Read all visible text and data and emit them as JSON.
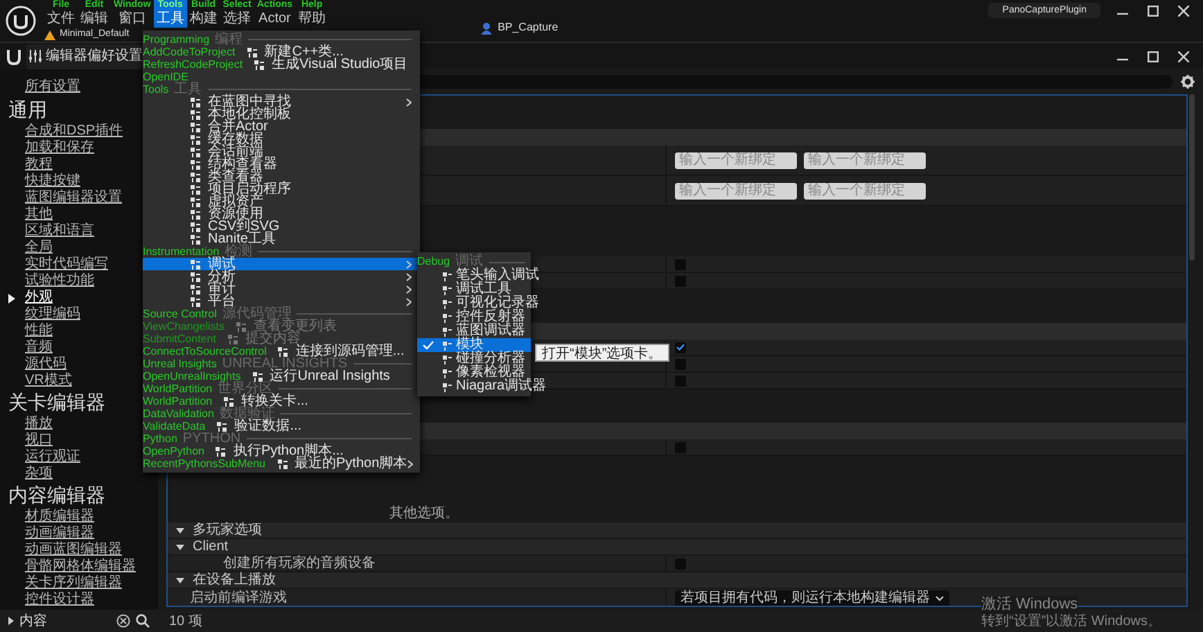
{
  "menu_bar": [
    {
      "debug_name": "File",
      "label": "文件",
      "selected": false
    },
    {
      "debug_name": "Edit",
      "label": "编辑",
      "selected": false
    },
    {
      "debug_name": "Window",
      "label": "窗口",
      "selected": false
    },
    {
      "debug_name": "Tools",
      "label": "工具",
      "selected": true
    },
    {
      "debug_name": "Build",
      "label": "构建",
      "selected": false
    },
    {
      "debug_name": "Select",
      "label": "选择",
      "selected": false
    },
    {
      "debug_name": "Actions",
      "label": "Actor",
      "selected": false
    },
    {
      "debug_name": "Help",
      "label": "帮助",
      "selected": false
    }
  ],
  "level_tab": "Minimal_Default",
  "blueprint_tab": "BP_Capture",
  "project_name": "PanoCapturePlugin",
  "settings_window": {
    "tab": "编辑器偏好设置"
  },
  "sidebar": {
    "all_settings": "所有设置",
    "sections": [
      {
        "title": "通用",
        "items": [
          {
            "label": "合成和DSP插件",
            "selected": false
          },
          {
            "label": "加载和保存",
            "selected": false
          },
          {
            "label": "教程",
            "selected": false
          },
          {
            "label": "快捷按键",
            "selected": false
          },
          {
            "label": "蓝图编辑器设置",
            "selected": false
          },
          {
            "label": "其他",
            "selected": false
          },
          {
            "label": "区域和语言",
            "selected": false
          },
          {
            "label": "全局",
            "selected": false
          },
          {
            "label": "实时代码编写",
            "selected": false
          },
          {
            "label": "试验性功能",
            "selected": false
          },
          {
            "label": "外观",
            "selected": true
          },
          {
            "label": "纹理编码",
            "selected": false
          },
          {
            "label": "性能",
            "selected": false
          },
          {
            "label": "音频",
            "selected": false
          },
          {
            "label": "源代码",
            "selected": false
          },
          {
            "label": "VR模式",
            "selected": false
          }
        ]
      },
      {
        "title": "关卡编辑器",
        "items": [
          {
            "label": "播放",
            "selected": false
          },
          {
            "label": "视口",
            "selected": false
          },
          {
            "label": "运行观证",
            "selected": false
          },
          {
            "label": "杂项",
            "selected": false
          }
        ]
      },
      {
        "title": "内容编辑器",
        "items": [
          {
            "label": "材质编辑器",
            "selected": false
          },
          {
            "label": "动画编辑器",
            "selected": false
          },
          {
            "label": "动画蓝图编辑器",
            "selected": false
          },
          {
            "label": "骨骼网格体编辑器",
            "selected": false
          },
          {
            "label": "关卡序列编辑器",
            "selected": false
          },
          {
            "label": "控件设计器",
            "selected": false
          }
        ]
      }
    ]
  },
  "content_drawer": {
    "label": "内容"
  },
  "status": "10 项",
  "settings": {
    "rows": [
      {
        "kind": "blank"
      },
      {
        "kind": "blank"
      },
      {
        "kind": "section"
      },
      {
        "kind": "binding",
        "placeholders": [
          "输入一个新绑定",
          "输入一个新绑定"
        ]
      },
      {
        "kind": "binding",
        "placeholders": [
          "输入一个新绑定",
          "输入一个新绑定"
        ]
      },
      {
        "kind": "blank"
      },
      {
        "kind": "blank"
      },
      {
        "kind": "blank"
      },
      {
        "kind": "checkbox",
        "checked": false
      },
      {
        "kind": "checkbox",
        "checked": false
      },
      {
        "kind": "blank"
      },
      {
        "kind": "blank"
      },
      {
        "kind": "section"
      },
      {
        "kind": "checkbox",
        "checked": true
      },
      {
        "kind": "checkbox",
        "checked": false
      },
      {
        "kind": "checkbox",
        "checked": false
      },
      {
        "kind": "blank"
      },
      {
        "kind": "blank"
      },
      {
        "kind": "section"
      },
      {
        "kind": "checkbox",
        "checked": false
      },
      {
        "kind": "blank"
      },
      {
        "kind": "blank"
      },
      {
        "kind": "blank"
      },
      {
        "kind": "note",
        "text": "其他选项。"
      },
      {
        "kind": "group",
        "label": "多玩家选项",
        "expanded": true
      },
      {
        "kind": "group",
        "label": "Client",
        "expanded": true
      },
      {
        "kind": "checkbox",
        "label": "创建所有玩家的音频设备",
        "checked": false
      },
      {
        "kind": "group",
        "label": "在设备上播放",
        "expanded": true
      },
      {
        "kind": "dropdown",
        "label": "启动前编译游戏",
        "value": "若项目拥有代码，则运行本地构建编辑器"
      }
    ]
  },
  "tools_menu": {
    "entries": [
      {
        "kind": "header",
        "debug_name": "Programming",
        "label": "编程"
      },
      {
        "kind": "item",
        "debug_name": "AddCodeToProject",
        "label": "新建C++类...",
        "disabled": false,
        "submenu": false,
        "selected": false
      },
      {
        "kind": "item",
        "debug_name": "RefreshCodeProject",
        "label": "生成Visual Studio项目",
        "disabled": false,
        "submenu": false,
        "selected": false
      },
      {
        "kind": "item",
        "debug_name": "OpenIDE",
        "disabled": false,
        "submenu": false,
        "selected": false
      },
      {
        "kind": "header",
        "debug_name": "Tools",
        "label": "工具"
      },
      {
        "kind": "item",
        "label": "在蓝图中寻找",
        "disabled": false,
        "submenu": true,
        "selected": false
      },
      {
        "kind": "item",
        "label": "本地化控制板",
        "disabled": false,
        "submenu": false,
        "selected": false
      },
      {
        "kind": "item",
        "label": "合并Actor",
        "disabled": false,
        "submenu": false,
        "selected": false
      },
      {
        "kind": "item",
        "label": "缓存数据",
        "disabled": false,
        "submenu": false,
        "selected": false
      },
      {
        "kind": "item",
        "label": "会话前端",
        "disabled": false,
        "submenu": false,
        "selected": false
      },
      {
        "kind": "item",
        "label": "结构查看器",
        "disabled": false,
        "submenu": false,
        "selected": false
      },
      {
        "kind": "item",
        "label": "类查看器",
        "disabled": false,
        "submenu": false,
        "selected": false
      },
      {
        "kind": "item",
        "label": "项目启动程序",
        "disabled": false,
        "submenu": false,
        "selected": false
      },
      {
        "kind": "item",
        "label": "虚拟资产",
        "disabled": false,
        "submenu": false,
        "selected": false
      },
      {
        "kind": "item",
        "label": "资源使用",
        "disabled": false,
        "submenu": false,
        "selected": false
      },
      {
        "kind": "item",
        "label": "CSV到SVG",
        "disabled": false,
        "submenu": false,
        "selected": false
      },
      {
        "kind": "item",
        "label": "Nanite工具",
        "disabled": false,
        "submenu": false,
        "selected": false
      },
      {
        "kind": "header",
        "debug_name": "Instrumentation",
        "label": "检测"
      },
      {
        "kind": "item",
        "label": "调试",
        "disabled": false,
        "submenu": true,
        "selected": true
      },
      {
        "kind": "item",
        "label": "分析",
        "disabled": false,
        "submenu": true,
        "selected": false
      },
      {
        "kind": "item",
        "label": "审计",
        "disabled": false,
        "submenu": true,
        "selected": false
      },
      {
        "kind": "item",
        "label": "平台",
        "disabled": false,
        "submenu": true,
        "selected": false
      },
      {
        "kind": "header",
        "debug_name": "Source Control",
        "label": "源代码管理"
      },
      {
        "kind": "item",
        "debug_name": "ViewChangelists",
        "label": "查看变更列表",
        "disabled": true,
        "submenu": false,
        "selected": false
      },
      {
        "kind": "item",
        "debug_name": "SubmitContent",
        "label": "提交内容",
        "disabled": true,
        "submenu": false,
        "selected": false
      },
      {
        "kind": "item",
        "debug_name": "ConnectToSourceControl",
        "label": "连接到源码管理...",
        "disabled": false,
        "submenu": false,
        "selected": false
      },
      {
        "kind": "header",
        "debug_name": "Unreal Insights",
        "label": "UNREAL INSIGHTS"
      },
      {
        "kind": "item",
        "debug_name": "OpenUnrealInsights",
        "label": "运行Unreal Insights",
        "disabled": false,
        "submenu": false,
        "selected": false
      },
      {
        "kind": "header",
        "debug_name": "WorldPartition",
        "label": "世界分区"
      },
      {
        "kind": "item",
        "debug_name": "WorldPartition",
        "label": "转换关卡...",
        "disabled": false,
        "submenu": false,
        "selected": false
      },
      {
        "kind": "header",
        "debug_name": "DataValidation",
        "label": "数据验证"
      },
      {
        "kind": "item",
        "debug_name": "ValidateData",
        "label": "验证数据...",
        "disabled": false,
        "submenu": false,
        "selected": false
      },
      {
        "kind": "header",
        "debug_name": "Python",
        "label": "PYTHON"
      },
      {
        "kind": "item",
        "debug_name": "OpenPython",
        "label": "执行Python脚本...",
        "disabled": false,
        "submenu": false,
        "selected": false
      },
      {
        "kind": "item",
        "debug_name": "RecentPythonsSubMenu",
        "label": "最近的Python脚本",
        "disabled": false,
        "submenu": true,
        "selected": false
      }
    ]
  },
  "debug_submenu": {
    "debug_name": "Debug",
    "label": "调试",
    "items": [
      {
        "label": "笔头输入调试",
        "checked": false,
        "selected": false
      },
      {
        "label": "调试工具",
        "checked": false,
        "selected": false
      },
      {
        "label": "可视化记录器",
        "checked": false,
        "selected": false
      },
      {
        "label": "控件反射器",
        "checked": false,
        "selected": false
      },
      {
        "label": "蓝图调试器",
        "checked": false,
        "selected": false
      },
      {
        "label": "模块",
        "checked": true,
        "selected": true
      },
      {
        "label": "碰撞分析器",
        "checked": false,
        "selected": false
      },
      {
        "label": "像素检视器",
        "checked": false,
        "selected": false
      },
      {
        "label": "Niagara调试器",
        "checked": false,
        "selected": false
      }
    ]
  },
  "tooltip": "打开“模块”选项卡。",
  "windows_notice": {
    "title": "激活 Windows",
    "text": "转到“设置”以激活 Windows。"
  }
}
